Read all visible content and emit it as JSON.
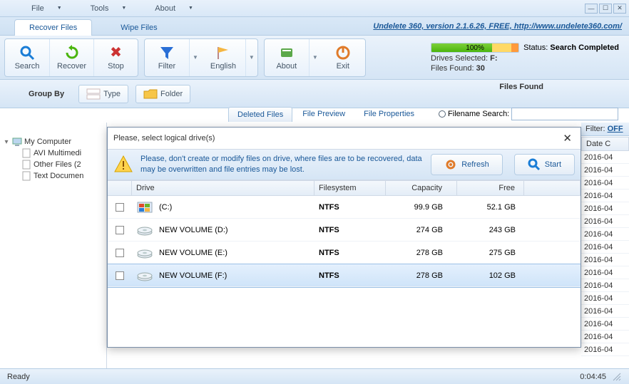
{
  "menu": {
    "file": "File",
    "tools": "Tools",
    "about": "About"
  },
  "tabs_main": {
    "recover": "Recover Files",
    "wipe": "Wipe Files"
  },
  "version_link": "Undelete 360, version 2.1.6.26, FREE, http://www.undelete360.com/",
  "toolbar": {
    "search": "Search",
    "recover": "Recover",
    "stop": "Stop",
    "filter": "Filter",
    "english": "English",
    "about": "About",
    "exit": "Exit"
  },
  "status": {
    "progress_pct": "100%",
    "drives_selected_label": "Drives Selected: ",
    "drives_selected_val": "F:",
    "files_found_label": "Files Found: ",
    "files_found_val": "30",
    "status_label": "Status: ",
    "status_val": "Search Completed"
  },
  "groupby": {
    "label": "Group By",
    "type": "Type",
    "folder": "Folder"
  },
  "files_found_header": "Files Found",
  "panel_tabs": {
    "deleted": "Deleted Files",
    "preview": "File Preview",
    "properties": "File Properties",
    "filename_search": "Filename Search:"
  },
  "tree": {
    "root": "My Computer",
    "items": [
      "AVI Multimedi",
      "Other Files (2",
      "Text Documen"
    ]
  },
  "right": {
    "filter_label": "Filter: ",
    "filter_val": "OFF",
    "date_head": "Date C"
  },
  "date_cells": [
    "2016-04",
    "2016-04",
    "2016-04",
    "2016-04",
    "2016-04",
    "2016-04",
    "2016-04",
    "2016-04",
    "2016-04",
    "2016-04",
    "2016-04",
    "2016-04",
    "2016-04",
    "2016-04",
    "2016-04",
    "2016-04"
  ],
  "modal": {
    "title": "Please, select logical drive(s)",
    "info": "Please, don't create or modify files on drive, where files are to be recovered, data may be overwritten and file entries may be lost.",
    "refresh": "Refresh",
    "start": "Start",
    "headers": {
      "drive": "Drive",
      "fs": "Filesystem",
      "cap": "Capacity",
      "free": "Free"
    },
    "rows": [
      {
        "label": "(C:)",
        "icon": "win",
        "fs": "NTFS",
        "cap": "99.9 GB",
        "free": "52.1 GB",
        "selected": false
      },
      {
        "label": "NEW VOLUME (D:)",
        "icon": "hdd",
        "fs": "NTFS",
        "cap": "274 GB",
        "free": "243 GB",
        "selected": false
      },
      {
        "label": "NEW VOLUME (E:)",
        "icon": "hdd",
        "fs": "NTFS",
        "cap": "278 GB",
        "free": "275 GB",
        "selected": false
      },
      {
        "label": "NEW VOLUME (F:)",
        "icon": "hdd",
        "fs": "NTFS",
        "cap": "278 GB",
        "free": "102 GB",
        "selected": true
      }
    ]
  },
  "statusbar": {
    "ready": "Ready",
    "elapsed": "0:04:45"
  }
}
